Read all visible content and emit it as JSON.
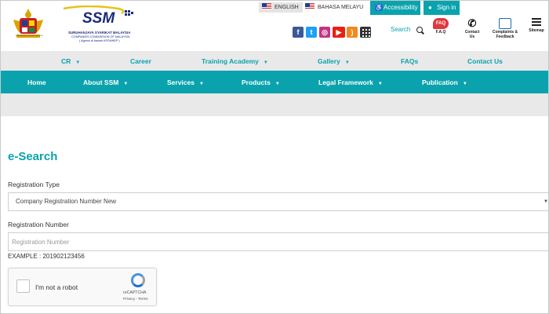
{
  "header": {
    "crest_motto": "SURUHANJAYA SYARIKAT MALAYSIA",
    "logo_text": "SSM",
    "tagline_1": "SURUHANJAYA SYARIKAT MALAYSIA",
    "tagline_2": "COMPANIES COMMISSION OF MALAYSIA",
    "tagline_3": "( Agensi di bawah KPDNHEP )",
    "lang_en": "ENGLISH",
    "lang_my": "BAHASA MELAYU",
    "accessibility": "Accessibility",
    "signin": "Sign in",
    "search_label": "Search",
    "faq_badge": "FAQ",
    "faq_label": "F.A.Q",
    "contact_label_1": "Contact",
    "contact_label_2": "Us",
    "complaints_label_1": "Complaints &",
    "complaints_label_2": "Feedback",
    "sitemap_label": "Sitemap",
    "social": {
      "facebook": "f",
      "twitter": "t",
      "instagram": "◎",
      "youtube": "▶",
      "rss": ")"
    }
  },
  "menu_top": [
    {
      "label": "CR",
      "caret": true
    },
    {
      "label": "Career",
      "caret": false
    },
    {
      "label": "Training Academy",
      "caret": true
    },
    {
      "label": "Gallery",
      "caret": true
    },
    {
      "label": "FAQs",
      "caret": false
    },
    {
      "label": "Contact Us",
      "caret": false
    }
  ],
  "menu_main": [
    {
      "label": "Home",
      "caret": false
    },
    {
      "label": "About SSM",
      "caret": true
    },
    {
      "label": "Services",
      "caret": true
    },
    {
      "label": "Products",
      "caret": true
    },
    {
      "label": "Legal Framework",
      "caret": true
    },
    {
      "label": "Publication",
      "caret": true
    }
  ],
  "caret_glyph": "▼",
  "form": {
    "title": "e-Search",
    "registration_type_label": "Registration Type",
    "registration_type_value": "Company Registration Number New",
    "registration_number_label": "Registration Number",
    "registration_number_placeholder": "Registration Number",
    "example": "EXAMPLE : 201902123456"
  },
  "captcha": {
    "label": "I'm not a robot",
    "brand": "reCAPTCHA",
    "links": "Privacy - Terms"
  },
  "colors": {
    "accent": "#0aa3ad",
    "menu_bg": "#e9e9e9",
    "faq_red": "#e0383e"
  }
}
